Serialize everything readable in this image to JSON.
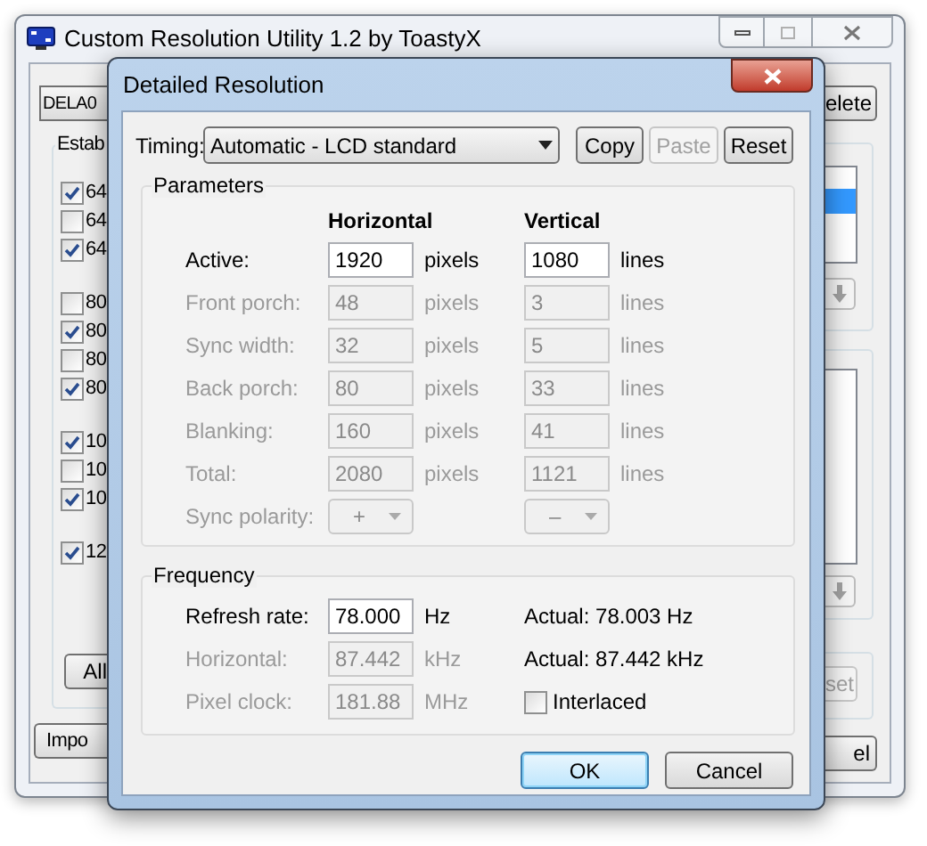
{
  "main_window": {
    "title": "Custom Resolution Utility 1.2 by ToastyX",
    "device_button": "DELA0",
    "group_label": "Estab",
    "checkbox_groups": [
      [
        {
          "label": "64",
          "checked": true
        },
        {
          "label": "64",
          "checked": false
        },
        {
          "label": "64",
          "checked": true
        }
      ],
      [
        {
          "label": "80",
          "checked": false
        },
        {
          "label": "80",
          "checked": true
        },
        {
          "label": "80",
          "checked": false
        },
        {
          "label": "80",
          "checked": true
        }
      ],
      [
        {
          "label": "10",
          "checked": true
        },
        {
          "label": "10",
          "checked": false
        },
        {
          "label": "10",
          "checked": true
        }
      ],
      [
        {
          "label": "12",
          "checked": true
        }
      ]
    ],
    "all_button": "All",
    "import_button": "Impo",
    "delete_button": "elete",
    "reset_button": "set",
    "cancel_button": "el"
  },
  "dialog": {
    "title": "Detailed Resolution",
    "timing_label": "Timing:",
    "timing_value": "Automatic - LCD standard",
    "buttons": [
      {
        "label": "Copy",
        "disabled": false
      },
      {
        "label": "Paste",
        "disabled": true
      },
      {
        "label": "Reset",
        "disabled": false
      }
    ],
    "parameters": {
      "title": "Parameters",
      "columns": [
        "Horizontal",
        "Vertical"
      ],
      "rows": [
        {
          "kind": "field",
          "label": "Active:",
          "enabled": true,
          "horizontal": "1920",
          "horizontal_unit": "pixels",
          "vertical": "1080",
          "vertical_unit": "lines"
        },
        {
          "kind": "field",
          "label": "Front porch:",
          "enabled": false,
          "horizontal": "48",
          "horizontal_unit": "pixels",
          "vertical": "3",
          "vertical_unit": "lines"
        },
        {
          "kind": "field",
          "label": "Sync width:",
          "enabled": false,
          "horizontal": "32",
          "horizontal_unit": "pixels",
          "vertical": "5",
          "vertical_unit": "lines"
        },
        {
          "kind": "field",
          "label": "Back porch:",
          "enabled": false,
          "horizontal": "80",
          "horizontal_unit": "pixels",
          "vertical": "33",
          "vertical_unit": "lines"
        },
        {
          "kind": "field",
          "label": "Blanking:",
          "enabled": false,
          "horizontal": "160",
          "horizontal_unit": "pixels",
          "vertical": "41",
          "vertical_unit": "lines"
        },
        {
          "kind": "field",
          "label": "Total:",
          "enabled": false,
          "horizontal": "2080",
          "horizontal_unit": "pixels",
          "vertical": "1121",
          "vertical_unit": "lines"
        },
        {
          "kind": "dropdown",
          "label": "Sync polarity:",
          "enabled": false,
          "horizontal": "+",
          "vertical": "–"
        }
      ]
    },
    "frequency": {
      "title": "Frequency",
      "rows": [
        {
          "label": "Refresh rate:",
          "enabled": true,
          "value": "78.000",
          "unit": "Hz",
          "extra": {
            "kind": "text",
            "text": "Actual: 78.003 Hz"
          }
        },
        {
          "label": "Horizontal:",
          "enabled": false,
          "value": "87.442",
          "unit": "kHz",
          "extra": {
            "kind": "text",
            "text": "Actual: 87.442 kHz"
          }
        },
        {
          "label": "Pixel clock:",
          "enabled": false,
          "value": "181.88",
          "unit": "MHz",
          "extra": {
            "kind": "checkbox",
            "label": "Interlaced",
            "checked": false
          }
        }
      ]
    },
    "ok_button": "OK",
    "cancel_button": "Cancel"
  }
}
